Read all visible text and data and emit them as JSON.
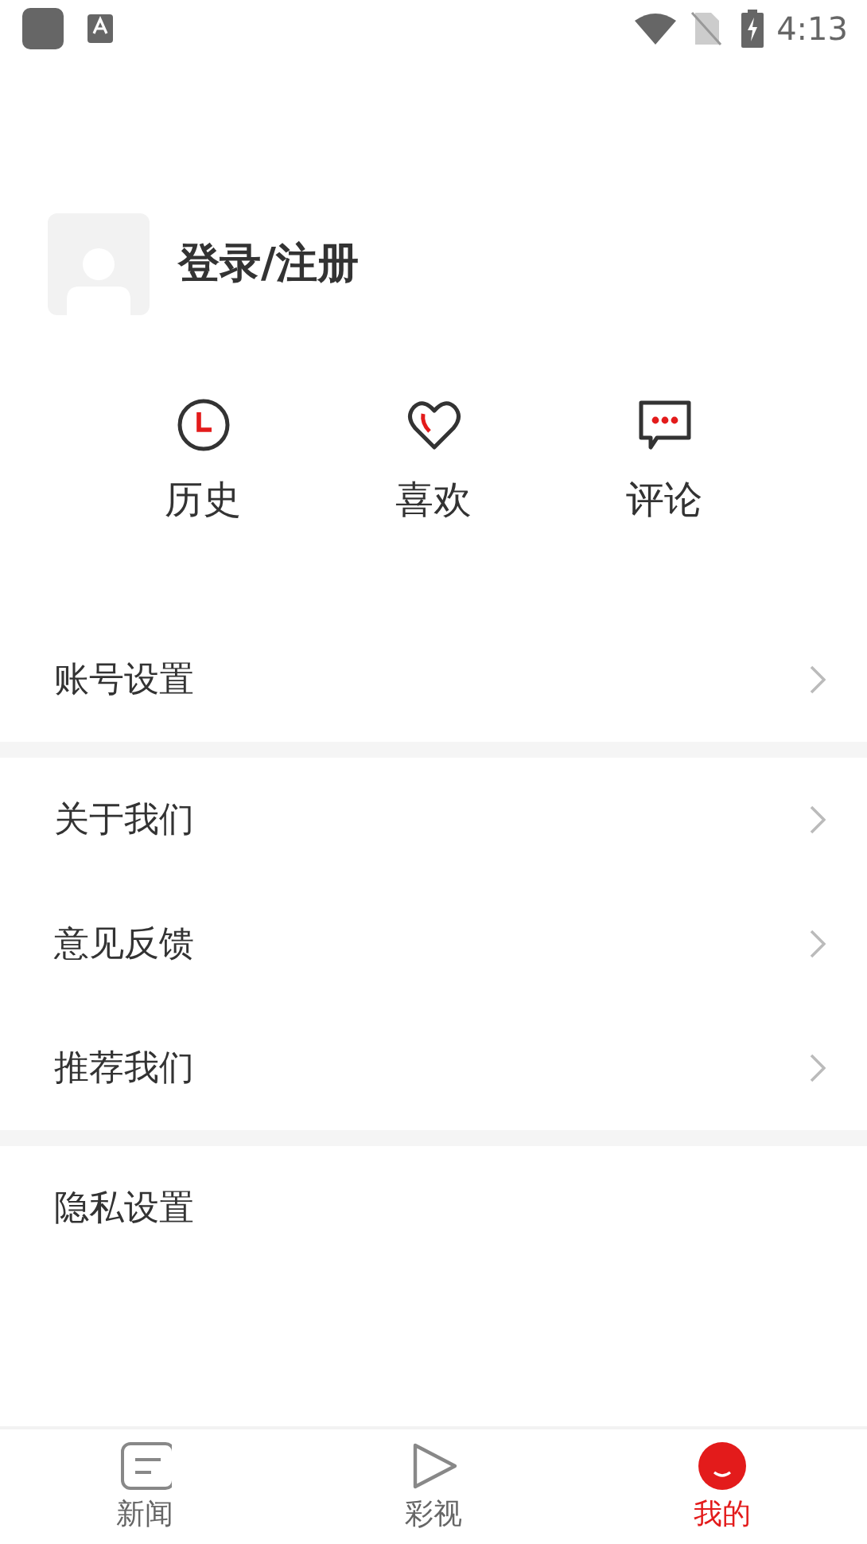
{
  "status_bar": {
    "time": "4:13"
  },
  "profile": {
    "login_label": "登录/注册"
  },
  "shortcuts": [
    {
      "kind": "history",
      "label": "历史"
    },
    {
      "kind": "like",
      "label": "喜欢"
    },
    {
      "kind": "comment",
      "label": "评论"
    }
  ],
  "menu_groups": [
    [
      {
        "label": "账号设置",
        "chevron": true
      }
    ],
    [
      {
        "label": "关于我们",
        "chevron": true
      },
      {
        "label": "意见反馈",
        "chevron": true
      },
      {
        "label": "推荐我们",
        "chevron": true
      }
    ],
    [
      {
        "label": "隐私设置",
        "chevron": false
      }
    ]
  ],
  "tab_bar": [
    {
      "kind": "news",
      "label": "新闻",
      "selected": false
    },
    {
      "kind": "video",
      "label": "彩视",
      "selected": false
    },
    {
      "kind": "me",
      "label": "我的",
      "selected": true
    }
  ]
}
